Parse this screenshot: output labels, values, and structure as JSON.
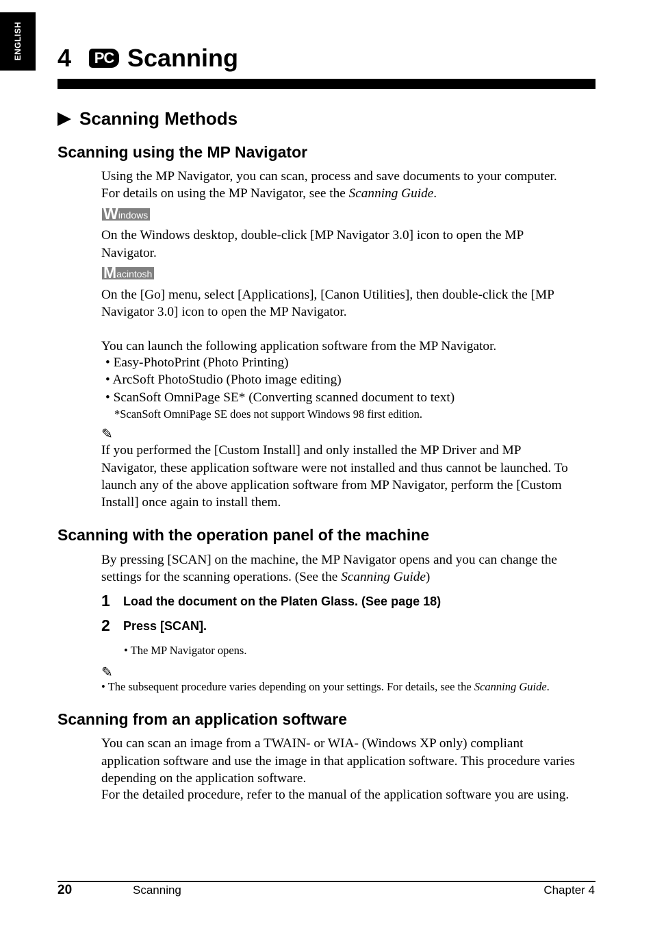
{
  "side_tab": {
    "label": "ENGLISH"
  },
  "chapter": {
    "number": "4",
    "icon_label": "PC",
    "title": "Scanning"
  },
  "section": {
    "title": "Scanning Methods"
  },
  "mp_navigator": {
    "heading": "Scanning using the MP Navigator",
    "intro_line1": "Using the MP Navigator, you can scan, process and save documents to your computer.",
    "intro_line2_pre": "For details on using the MP Navigator, see the ",
    "intro_line2_italic": "Scanning Guide",
    "intro_line2_post": ".",
    "windows_badge": {
      "initial": "W",
      "rest": "indows"
    },
    "windows_line1": "On the Windows desktop, double-click [MP Navigator 3.0] icon to open the MP",
    "windows_line2": "Navigator.",
    "mac_badge": {
      "initial": "M",
      "rest": "acintosh"
    },
    "mac_line1": "On the [Go] menu, select [Applications], [Canon Utilities], then double-click the [MP",
    "mac_line2": "Navigator 3.0] icon to open the MP Navigator.",
    "launch_intro": "You can launch the following application software from the MP Navigator.",
    "apps": [
      "Easy-PhotoPrint (Photo Printing)",
      "ArcSoft PhotoStudio (Photo image editing)",
      "ScanSoft OmniPage SE* (Converting scanned document to text)"
    ],
    "footnote": "*ScanSoft OmniPage SE does not support Windows 98 first edition.",
    "note_lines": [
      "If you performed the [Custom Install] and only installed the MP Driver and MP",
      "Navigator, these application software were not installed and thus cannot be launched. To",
      "launch any of the above application software from MP Navigator, perform the [Custom",
      "Install] once again to install them."
    ]
  },
  "operation_panel": {
    "heading": "Scanning with the operation panel of the machine",
    "line1": "By pressing [SCAN] on the machine, the MP Navigator opens and you can change the",
    "line2_pre": "settings for the scanning operations. (See the ",
    "line2_italic": "Scanning Guide",
    "line2_post": ")",
    "steps": [
      {
        "num": "1",
        "text": "Load the document on the Platen Glass. (See page 18)"
      },
      {
        "num": "2",
        "text": "Press [SCAN]."
      }
    ],
    "step_bullet": "The MP Navigator opens.",
    "note_pre": "The subsequent procedure varies depending on your settings. For details, see the ",
    "note_italic": "Scanning Guide",
    "note_post": "."
  },
  "application": {
    "heading": "Scanning from an application software",
    "lines": [
      "You can scan an image from a TWAIN- or WIA- (Windows XP only) compliant",
      "application software and use the image in that application software. This procedure varies",
      "depending on the application software.",
      "For the detailed procedure, refer to the manual of the application software you are using."
    ]
  },
  "footer": {
    "page_number": "20",
    "section": "Scanning",
    "chapter": "Chapter 4"
  },
  "icons": {
    "note": "pencil-icon",
    "pc": "pc-icon",
    "section_marker": "triangle-right-icon"
  }
}
